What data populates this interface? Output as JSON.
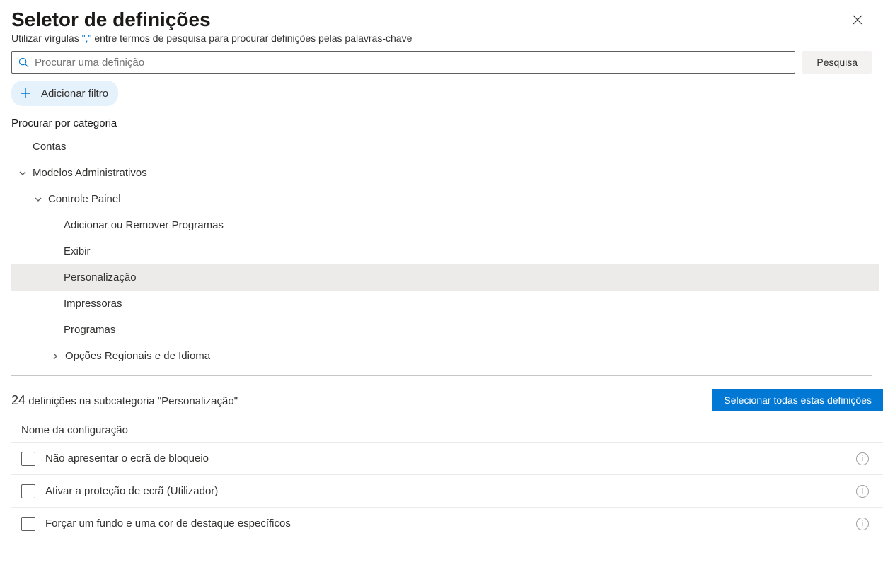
{
  "header": {
    "title": "Seletor de definições",
    "subtitle_prefix": "Utilizar vírgulas ",
    "subtitle_quoted": "\",\"",
    "subtitle_suffix": " entre termos de pesquisa para procurar definições pelas palavras-chave"
  },
  "search": {
    "placeholder": "Procurar uma definição",
    "button": "Pesquisa"
  },
  "filter": {
    "add_label": "Adicionar filtro"
  },
  "browse": {
    "label": "Procurar por categoria"
  },
  "tree": {
    "items": [
      {
        "label": "Contas",
        "depth": 1,
        "chev": ""
      },
      {
        "label": "Modelos Administrativos",
        "depth": 2,
        "chev": "down"
      },
      {
        "label": "Controle  Painel",
        "depth": 3,
        "chev": "down"
      },
      {
        "label": "Adicionar ou Remover Programas",
        "depth": 4,
        "chev": ""
      },
      {
        "label": "Exibir",
        "depth": 4,
        "chev": ""
      },
      {
        "label": "Personalização",
        "depth": 4,
        "chev": "",
        "selected": true
      },
      {
        "label": "Impressoras",
        "depth": 4,
        "chev": ""
      },
      {
        "label": "Programas",
        "depth": 4,
        "chev": ""
      },
      {
        "label": "Opções Regionais e de Idioma",
        "depth": 4,
        "sub": "b",
        "chev": "right"
      }
    ]
  },
  "results": {
    "count": "24",
    "text": " definições na subcategoria \"Personalização\"",
    "select_all": "Selecionar todas estas definições",
    "column_header": "Nome da configuração",
    "settings": [
      {
        "name": "Não apresentar o ecrã de bloqueio"
      },
      {
        "name": "Ativar a proteção de ecrã (Utilizador)"
      },
      {
        "name": "Forçar um fundo e uma cor de destaque específicos"
      }
    ]
  }
}
